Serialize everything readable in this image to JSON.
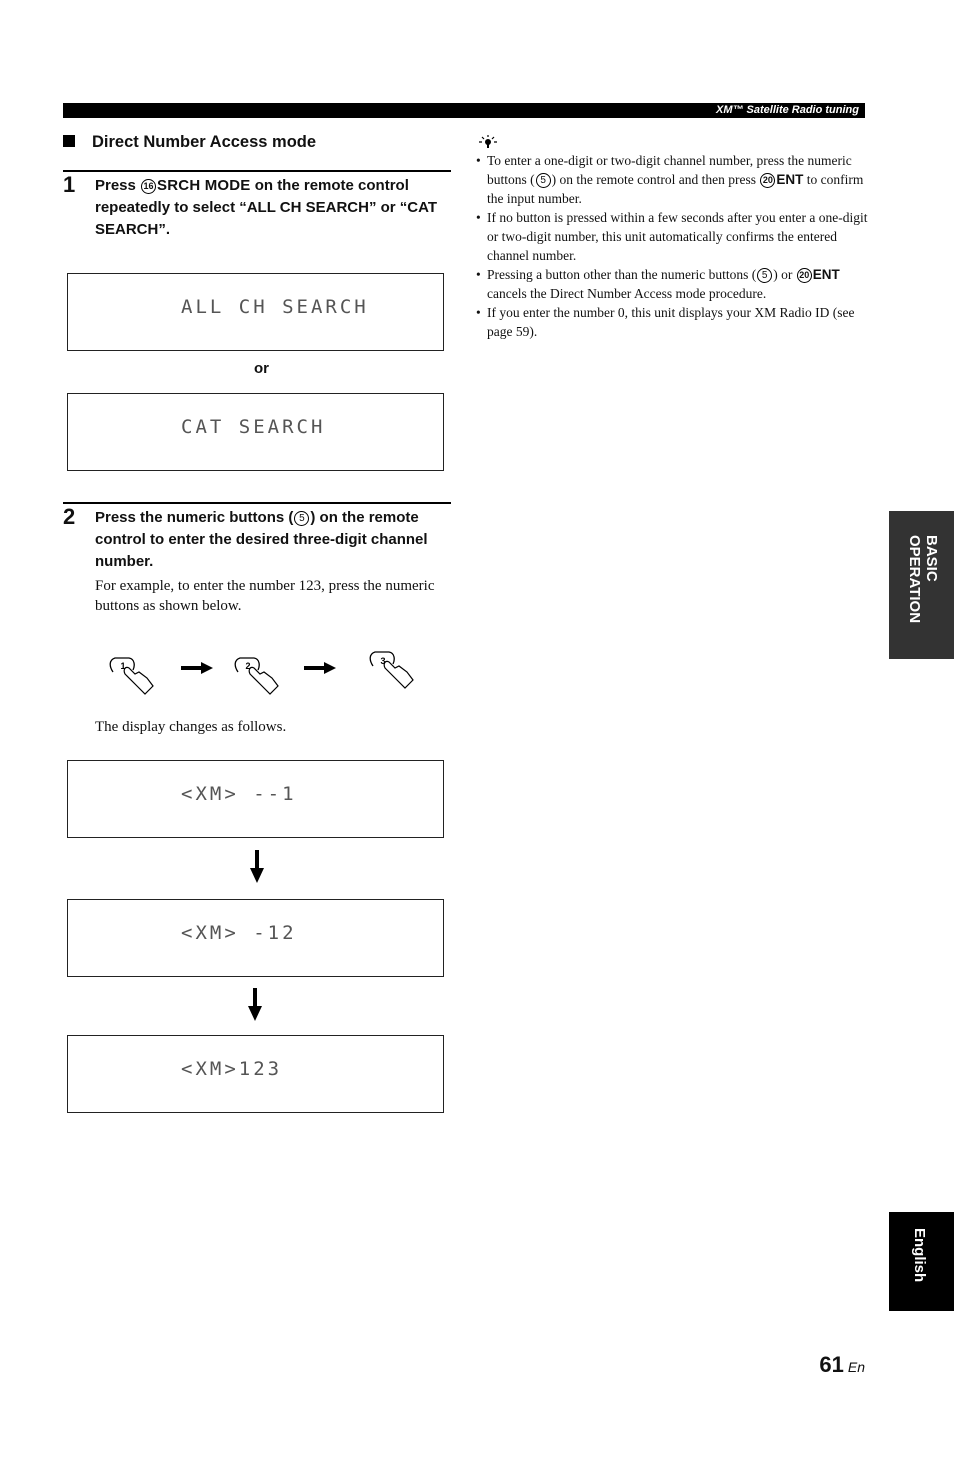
{
  "header": {
    "title": "XM™ Satellite Radio tuning"
  },
  "section": {
    "title": "Direct Number Access mode"
  },
  "step1": {
    "number": "1",
    "text_pre": "Press ",
    "button_ref": "16",
    "button_name": "SRCH MODE",
    "text_post": " on the remote control repeatedly to select “ALL CH SEARCH” or “CAT SEARCH”.",
    "display1": "ALL CH SEARCH",
    "or_label": "or",
    "display2": "CAT SEARCH"
  },
  "step2": {
    "number": "2",
    "text_pre": "Press the numeric buttons (",
    "button_ref": "5",
    "text_post": ") on the remote control to enter the desired three-digit channel number.",
    "body": "For example, to enter the number 123, press the numeric buttons as shown below.",
    "keys": [
      "1",
      "2",
      "3"
    ],
    "display_note": "The display changes as follows.",
    "displays": [
      "<XM> --1",
      "<XM> -12",
      "<XM>123"
    ]
  },
  "tips": {
    "icon": "tip-lightbulb-icon",
    "items": [
      {
        "pre": "To enter a one-digit or two-digit channel number, press the numeric buttons (",
        "ref1": "5",
        "mid": ") on the remote control and then press ",
        "ref2": "20",
        "key": "ENT",
        "post": " to confirm the input number."
      },
      {
        "text": "If no button is pressed within a few seconds after you enter a one-digit or two-digit number, this unit automatically confirms the entered channel number."
      },
      {
        "pre": "Pressing a button other than the numeric buttons (",
        "ref1": "5",
        "mid": ") or ",
        "ref2": "20",
        "key": "ENT",
        "post": " cancels the Direct Number Access mode procedure."
      },
      {
        "text": "If you enter the number 0, this unit displays your XM Radio ID (see page 59)."
      }
    ]
  },
  "side_tabs": {
    "section": "BASIC OPERATION",
    "language": "English"
  },
  "footer": {
    "page_number": "61",
    "lang_suffix": "En"
  }
}
